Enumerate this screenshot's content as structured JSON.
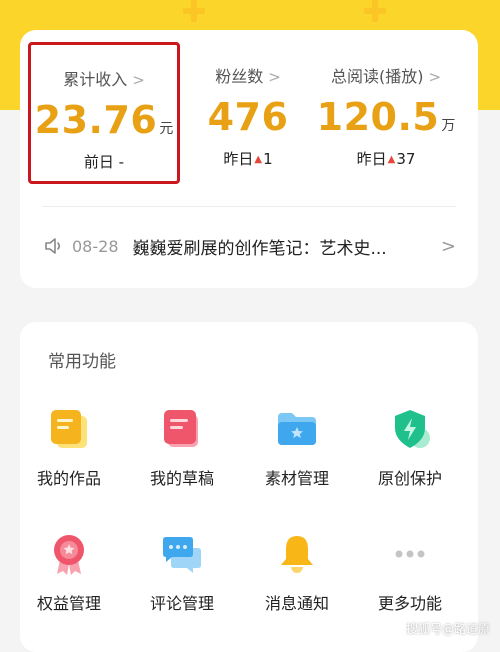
{
  "stats": [
    {
      "label": "累计收入",
      "value": "23.76",
      "unit": "元",
      "sub_prefix": "前日 -",
      "sub_value": ""
    },
    {
      "label": "粉丝数",
      "value": "476",
      "unit": "",
      "sub_prefix": "昨日",
      "sub_value": "1"
    },
    {
      "label": "总阅读(播放)",
      "value": "120.5",
      "unit": "万",
      "sub_prefix": "昨日",
      "sub_value": "37"
    }
  ],
  "chevron": ">",
  "up_marker": "▲",
  "notice": {
    "date": "08-28",
    "title": "巍巍爱刷展的创作笔记：艺术史...",
    "arrow": ">"
  },
  "functions": {
    "title": "常用功能",
    "items": [
      {
        "label": "我的作品",
        "icon": "works-icon"
      },
      {
        "label": "我的草稿",
        "icon": "drafts-icon"
      },
      {
        "label": "素材管理",
        "icon": "folder-icon"
      },
      {
        "label": "原创保护",
        "icon": "shield-icon"
      },
      {
        "label": "权益管理",
        "icon": "badge-icon"
      },
      {
        "label": "评论管理",
        "icon": "comment-icon"
      },
      {
        "label": "消息通知",
        "icon": "bell-icon"
      },
      {
        "label": "更多功能",
        "icon": "more-icon"
      }
    ]
  },
  "watermark": "搜狐号@路道原",
  "colors": {
    "accent_yellow": "#fcd52b",
    "value_orange": "#e8a114",
    "highlight_red": "#c9191e",
    "up_red": "#e5463b"
  }
}
